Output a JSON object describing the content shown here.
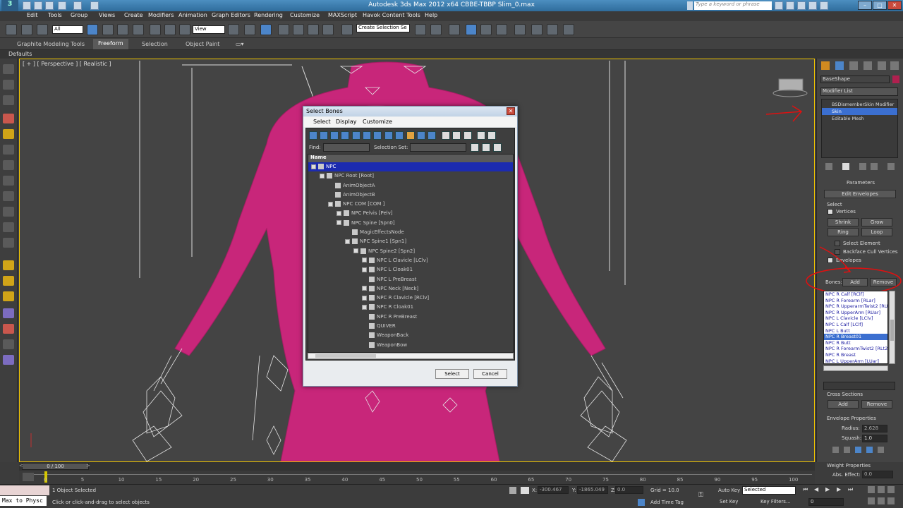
{
  "window": {
    "title": "Autodesk 3ds Max 2012 x64        CBBE-TBBP Slim_0.max",
    "search_placeholder": "Type a keyword or phrase"
  },
  "menubar": [
    "Edit",
    "Tools",
    "Group",
    "Views",
    "Create",
    "Modifiers",
    "Animation",
    "Graph Editors",
    "Rendering",
    "Customize",
    "MAXScript",
    "Havok Content Tools",
    "Help"
  ],
  "toolbar": {
    "selection_filter": "All",
    "ref_coord": "View",
    "named_selection": "Create Selection Se"
  },
  "ribbon": {
    "tabs": [
      "Graphite Modeling Tools",
      "Freeform",
      "Selection",
      "Object Paint"
    ],
    "defaults_label": "Defaults"
  },
  "viewport": {
    "label": "[ + ] [ Perspective ] [ Realistic ]"
  },
  "dialog": {
    "title": "Select Bones",
    "menu": [
      "Select",
      "Display",
      "Customize"
    ],
    "find_label": "Find:",
    "selection_set_label": "Selection Set:",
    "column_header": "Name",
    "tree": [
      {
        "label": "NPC",
        "indent": 0,
        "sel": true,
        "exp": true
      },
      {
        "label": "NPC Root [Root]",
        "indent": 1,
        "exp": true
      },
      {
        "label": "AnimObjectA",
        "indent": 2
      },
      {
        "label": "AnimObjectB",
        "indent": 2
      },
      {
        "label": "NPC COM [COM ]",
        "indent": 2,
        "exp": true
      },
      {
        "label": "NPC Pelvis [Pelv]",
        "indent": 3,
        "exp": true
      },
      {
        "label": "NPC Spine [Spn0]",
        "indent": 3,
        "exp": true
      },
      {
        "label": "MagicEffectsNode",
        "indent": 4
      },
      {
        "label": "NPC Spine1 [Spn1]",
        "indent": 4,
        "exp": true
      },
      {
        "label": "NPC Spine2 [Spn2]",
        "indent": 5,
        "exp": true
      },
      {
        "label": "NPC L Clavicle [LClv]",
        "indent": 6,
        "exp": true
      },
      {
        "label": "NPC L Cloak01",
        "indent": 6,
        "exp": true
      },
      {
        "label": "NPC L PreBreast",
        "indent": 6
      },
      {
        "label": "NPC Neck [Neck]",
        "indent": 6,
        "exp": true
      },
      {
        "label": "NPC R Clavicle [RClv]",
        "indent": 6,
        "exp": true
      },
      {
        "label": "NPC R Cloak01",
        "indent": 6,
        "exp": true
      },
      {
        "label": "NPC R PreBreast",
        "indent": 6
      },
      {
        "label": "QUIVER",
        "indent": 6
      },
      {
        "label": "WeaponBack",
        "indent": 6
      },
      {
        "label": "WeaponBow",
        "indent": 6
      }
    ],
    "select_button": "Select",
    "cancel_button": "Cancel"
  },
  "command_panel": {
    "object_name": "BaseShape",
    "modifier_list_label": "Modifier List",
    "stack": [
      {
        "label": "BSDismemberSkin Modifier",
        "sel": false
      },
      {
        "label": "Skin",
        "sel": true
      },
      {
        "label": "Editable Mesh",
        "sel": false
      }
    ],
    "rollout_title": "Parameters",
    "edit_envelopes": "Edit Envelopes",
    "select_label": "Select",
    "vertices": "Vertices",
    "shrink": "Shrink",
    "grow": "Grow",
    "ring": "Ring",
    "loop": "Loop",
    "select_element": "Select Element",
    "backface": "Backface Cull Vertices",
    "envelopes": "Envelopes",
    "bones_label": "Bones:",
    "add": "Add",
    "remove": "Remove",
    "bones": [
      "NPC R Calf [RClf]",
      "NPC R Forearm [RLar]",
      "NPC R UpperarmTwist2 [RUt",
      "NPC R UpperArm [RUar]",
      "NPC L Clavicle [LClv]",
      "NPC L Calf [LClf]",
      "NPC L Butt",
      "NPC R Breast01",
      "NPC R Butt",
      "NPC R ForearmTwist2 [RLt2]",
      "NPC R Breast",
      "NPC L UpperArm [LUar]"
    ],
    "selected_bone": "NPC R Breast01",
    "cross_sections": "Cross Sections",
    "envelope_properties": "Envelope Properties",
    "radius_label": "Radius:",
    "radius": "2.628",
    "squash_label": "Squash:",
    "squash": "1.0",
    "weight_properties": "Weight Properties",
    "abs_effect": "Abs. Effect:",
    "abs_value": "0.0"
  },
  "timeline": {
    "frame": "0 / 100",
    "ticks": [
      "0",
      "5",
      "10",
      "15",
      "20",
      "25",
      "30",
      "35",
      "40",
      "45",
      "50",
      "55",
      "60",
      "65",
      "70",
      "75",
      "80",
      "85",
      "90",
      "95",
      "100"
    ]
  },
  "status": {
    "selection": "1 Object Selected",
    "prompt": "Click or click-and-drag to select objects",
    "x_label": "X:",
    "x": "-300.467",
    "y_label": "Y:",
    "y": "-1865.049",
    "z_label": "Z:",
    "z": "0.0",
    "grid": "Grid = 10.0",
    "add_time_tag": "Add Time Tag",
    "auto_key": "Auto Key",
    "auto_key_mode": "Selected",
    "set_key": "Set Key",
    "key_filters": "Key Filters...",
    "frame_field": "0",
    "maxscript": "Max to Physc"
  }
}
